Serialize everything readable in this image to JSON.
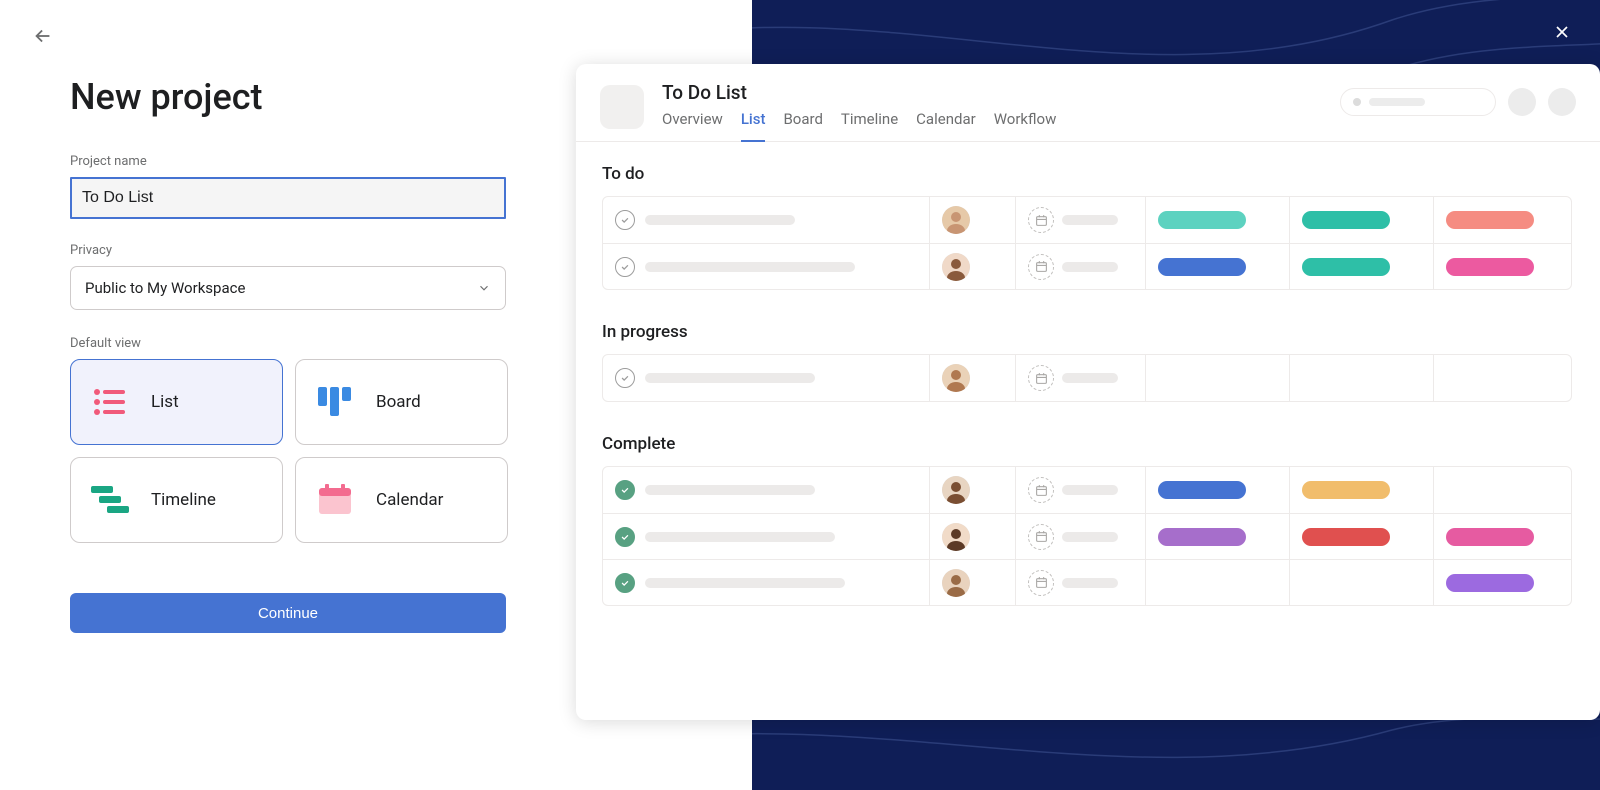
{
  "page": {
    "title": "New project",
    "fields": {
      "project_name": {
        "label": "Project name",
        "value": "To Do List"
      },
      "privacy": {
        "label": "Privacy",
        "value": "Public to My Workspace"
      },
      "default_view": {
        "label": "Default view"
      }
    },
    "views": {
      "list": "List",
      "board": "Board",
      "timeline": "Timeline",
      "calendar": "Calendar"
    },
    "continue": "Continue"
  },
  "preview": {
    "project_title": "To Do List",
    "tabs": {
      "overview": "Overview",
      "list": "List",
      "board": "Board",
      "timeline": "Timeline",
      "calendar": "Calendar",
      "workflow": "Workflow"
    },
    "sections": {
      "todo": "To do",
      "inprogress": "In progress",
      "complete": "Complete"
    }
  }
}
